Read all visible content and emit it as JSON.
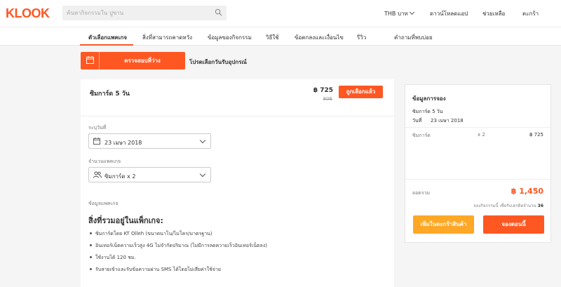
{
  "header": {
    "logo": "KLOOK",
    "search_placeholder": "ค้นหากิจกรรมใน ปูซาน",
    "currency": "THB",
    "currency_unit": "บาท",
    "download_app": "ดาวน์โหลดแอป",
    "help": "ช่วยเหลือ",
    "cart": "ตะกร้า"
  },
  "tabs": [
    {
      "label": "ตัวเลือกแพคเกจ",
      "active": true
    },
    {
      "label": "สิ่งที่สามารถคาดหวัง"
    },
    {
      "label": "ข้อมูลของกิจกรรม"
    },
    {
      "label": "วิธีใช้"
    },
    {
      "label": "ข้อตกลงและเงื่อนไข"
    },
    {
      "label": "รีวิว"
    },
    {
      "label": "คำถามที่พบบ่อย"
    }
  ],
  "availability": {
    "check_label": "ตรวจสอบที่ว่าง",
    "hint": "โปรดเลือกวันรับอุปกรณ์"
  },
  "package": {
    "name": "ซิมการ์ด 5 วัน",
    "price": "฿ 725",
    "old_price": "806",
    "selected_label": "ถูกเลือกแล้ว",
    "date_label": "ระบุวันที่",
    "date_value": "23 เมษา 2018",
    "qty_label": "จำนวนแพคเกจ",
    "qty_value": "ซิมการ์ด x 2",
    "info_label": "ข้อมูลแพคเกจ",
    "includes_title": "สิ่งที่รวมอยู่ในแพ็กเกจ:",
    "includes": [
      "ซิมการ์ดโดย KT Olleh (ขนาดนาโน/ไมโคร/มาตรฐาน)",
      "อินเทอร์เน็ตความเร็วสูง 4G ไม่จำกัดปริมาณ (ไม่มีการลดความเร็วอินเทอร์เน็ตลง)",
      "ใช้งานได้ 120 ชม.",
      "รับสายเข้าและรับข้อความผ่าน SMS ได้โดยไม่เสียค่าใช้จ่าย"
    ]
  },
  "booking": {
    "title": "ข้อมูลการจอง",
    "item_name": "ซิมการ์ด 5 วัน",
    "date_label": "วันที่",
    "date_value": "23 เมษา 2018",
    "line_item": "ซิมการ์ด",
    "line_qty": "x 2",
    "line_amount": "฿ 725",
    "total_label": "ยอดรวม",
    "total_value": "฿ 1,450",
    "points_text": "จองกิจกรรมนี้ เพื่อรับเครดิตจำนวน",
    "points_value": "36",
    "add_to_cart": "เพิ่มในตะกร้าสินค้า",
    "book_now": "จองตอนนี้"
  }
}
